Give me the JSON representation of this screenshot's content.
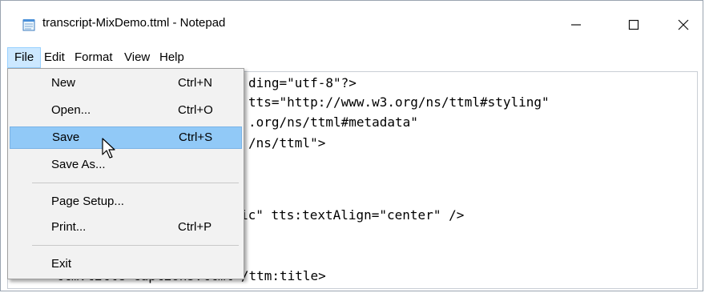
{
  "window": {
    "title": "transcript-MixDemo.ttml - Notepad",
    "minimize_icon": "minimize-icon",
    "maximize_icon": "maximize-icon",
    "close_icon": "close-icon"
  },
  "menubar": {
    "items": [
      {
        "label": "File",
        "active": true
      },
      {
        "label": "Edit",
        "active": false
      },
      {
        "label": "Format",
        "active": false
      },
      {
        "label": "View",
        "active": false
      },
      {
        "label": "Help",
        "active": false
      }
    ]
  },
  "file_menu": {
    "items": [
      {
        "label": "New",
        "shortcut": "Ctrl+N"
      },
      {
        "label": "Open...",
        "shortcut": "Ctrl+O"
      },
      {
        "label": "Save",
        "shortcut": "Ctrl+S",
        "highlighted": true
      },
      {
        "label": "Save As...",
        "shortcut": ""
      },
      {
        "label": "Page Setup...",
        "shortcut": ""
      },
      {
        "label": "Print...",
        "shortcut": "Ctrl+P"
      },
      {
        "label": "Exit",
        "shortcut": ""
      }
    ]
  },
  "editor": {
    "lines": [
      "ding=\"utf-8\"?>",
      "tts=\"http://www.w3.org/ns/ttml#styling\"",
      ".org/ns/ttml#metadata\"",
      "/ns/ttml\">",
      "ic\" tts:textAlign=\"center\" />",
      "<ttm:title>captions.ttml</ttm:title>"
    ]
  },
  "colors": {
    "menu_active_bg": "#cce8ff",
    "dropdown_highlight": "#91c9f7",
    "dropdown_bg": "#f2f2f2"
  }
}
